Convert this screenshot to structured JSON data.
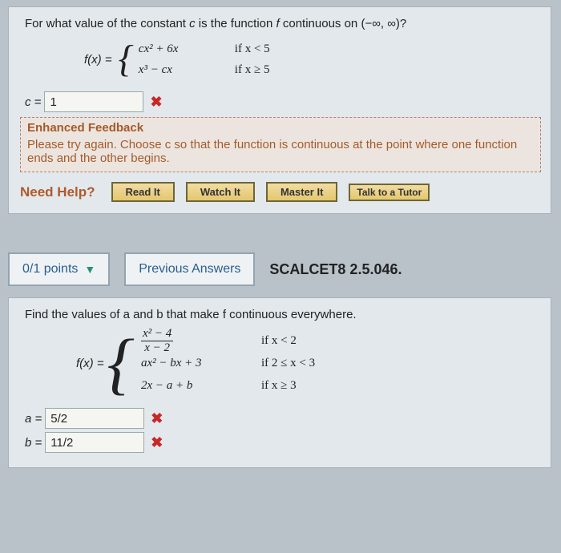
{
  "q1": {
    "prompt_pre": "For what value of the constant ",
    "prompt_c": "c",
    "prompt_mid": " is the function ",
    "prompt_f": "f",
    "prompt_post": " continuous on (−∞, ∞)?",
    "fx_label": "f(x) = ",
    "row1_expr": "cx² + 6x",
    "row1_cond": "if x < 5",
    "row2_expr": "x³ − cx",
    "row2_cond": "if x ≥ 5",
    "ans_label": "c = ",
    "ans_value": "1",
    "feedback_title": "Enhanced Feedback",
    "feedback_body": "Please try again. Choose c so that the function is continuous at the point where one function ends and the other begins.",
    "need_help": "Need Help?",
    "btn_read": "Read It",
    "btn_watch": "Watch It",
    "btn_master": "Master It",
    "btn_tutor": "Talk to a Tutor"
  },
  "header": {
    "points": "0/1 points",
    "prev": "Previous Answers",
    "ref": "SCALCET8 2.5.046."
  },
  "q2": {
    "prompt": "Find the values of a and b that make f continuous everywhere.",
    "fx_label": "f(x) = ",
    "r1_num": "x² − 4",
    "r1_den": "x − 2",
    "r1_cond": "if x < 2",
    "r2_expr": "ax² − bx + 3",
    "r2_cond": "if 2 ≤ x < 3",
    "r3_expr": "2x − a + b",
    "r3_cond": "if x ≥ 3",
    "a_label": "a = ",
    "a_value": "5/2",
    "b_label": "b = ",
    "b_value": "11/2"
  }
}
